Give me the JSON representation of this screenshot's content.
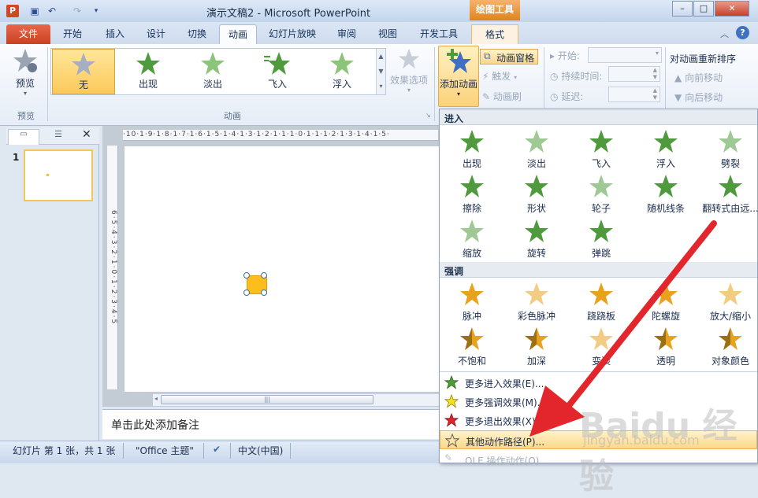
{
  "window": {
    "title": "演示文稿2 - Microsoft PowerPoint",
    "contextual_tab": "绘图工具",
    "app_icon_letter": "P",
    "controls": {
      "minimize": "–",
      "maximize": "□",
      "close": "✕"
    }
  },
  "tabs": [
    {
      "label": "文件",
      "active": false
    },
    {
      "label": "开始",
      "active": false
    },
    {
      "label": "插入",
      "active": false
    },
    {
      "label": "设计",
      "active": false
    },
    {
      "label": "切换",
      "active": false
    },
    {
      "label": "动画",
      "active": true
    },
    {
      "label": "幻灯片放映",
      "active": false
    },
    {
      "label": "审阅",
      "active": false
    },
    {
      "label": "视图",
      "active": false
    },
    {
      "label": "开发工具",
      "active": false
    },
    {
      "label": "格式",
      "active": false
    }
  ],
  "ribbon": {
    "preview_group": {
      "button": "预览",
      "label": "预览"
    },
    "animation_group": {
      "label": "动画",
      "gallery": [
        "无",
        "出现",
        "淡出",
        "飞入",
        "浮入"
      ],
      "effect_options": "效果选项"
    },
    "advanced_group": {
      "add_animation": "添加动画",
      "animation_pane": "动画窗格",
      "trigger": "触发",
      "animation_painter": "动画刷"
    },
    "timing_group": {
      "start": "开始:",
      "duration": "持续时间:",
      "delay": "延迟:",
      "reorder_title": "对动画重新排序",
      "move_earlier": "向前移动",
      "move_later": "向后移动"
    }
  },
  "left_pane": {
    "slide_number": "1"
  },
  "editor": {
    "ruler_h": "·10·1·9·1·8·1·7·1·6·1·5·1·4·1·3·1·2·1·1·1·0·1·1·1·2·1·3·1·4·1·5·",
    "ruler_v": "6·5·4·3·2·1·0·1·2·3·4·5",
    "notes_placeholder": "单击此处添加备注"
  },
  "status_bar": {
    "slide_info": "幻灯片 第 1 张，共 1 张",
    "theme": "\"Office 主题\"",
    "language": "中文(中国)"
  },
  "dropdown": {
    "entrance_header": "进入",
    "entrance_effects": [
      "出现",
      "淡出",
      "飞入",
      "浮入",
      "劈裂",
      "擦除",
      "形状",
      "轮子",
      "随机线条",
      "翻转式由远...",
      "缩放",
      "旋转",
      "弹跳"
    ],
    "emphasis_header": "强调",
    "emphasis_effects": [
      "脉冲",
      "彩色脉冲",
      "跷跷板",
      "陀螺旋",
      "放大/缩小",
      "不饱和",
      "加深",
      "变淡",
      "透明",
      "对象颜色"
    ],
    "menu": [
      {
        "label": "更多进入效果(E)...",
        "key": "entrance"
      },
      {
        "label": "更多强调效果(M)...",
        "key": "emphasis"
      },
      {
        "label": "更多退出效果(X)...",
        "key": "exit"
      },
      {
        "label": "其他动作路径(P)...",
        "key": "paths",
        "highlighted": true
      },
      {
        "label": "OLE 操作动作(O)...",
        "key": "ole",
        "disabled": true
      }
    ]
  },
  "watermark": {
    "brand": "Baidu 经验",
    "url": "jingyan.baidu.com"
  },
  "colors": {
    "entrance_star": "#4e9a3c",
    "emphasis_star": "#e8a21e",
    "exit_star": "#d9262f",
    "arrow": "#e3262b",
    "file_tab": "#d24726",
    "selection": "#fbd27a"
  }
}
